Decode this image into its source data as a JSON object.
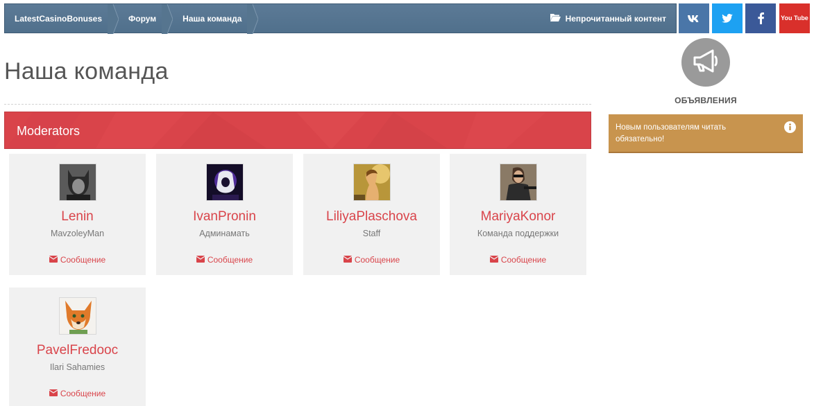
{
  "breadcrumbs": [
    {
      "label": "LatestCasinoBonuses"
    },
    {
      "label": "Форум"
    },
    {
      "label": "Наша команда"
    }
  ],
  "unread": {
    "label": "Непрочитанный контент",
    "icon": "folder-open-icon"
  },
  "social": [
    {
      "name": "vk",
      "icon": "vk-icon",
      "color": "#4a76a8"
    },
    {
      "name": "twitter",
      "icon": "twitter-icon",
      "color": "#1da1f2"
    },
    {
      "name": "facebook",
      "icon": "facebook-icon",
      "color": "#3b5998"
    },
    {
      "name": "youtube",
      "icon": "youtube-icon",
      "color": "#d9302b",
      "text": "You Tube"
    }
  ],
  "page": {
    "title": "Наша команда"
  },
  "group": {
    "title": "Moderators",
    "color": "#d9444a"
  },
  "members": [
    {
      "name": "Lenin",
      "title": "MavzoleyMan",
      "message_label": "Сообщение"
    },
    {
      "name": "IvanPronin",
      "title": "Админамать",
      "message_label": "Сообщение"
    },
    {
      "name": "LiliyaPlaschova",
      "title": "Staff",
      "message_label": "Сообщение"
    },
    {
      "name": "MariyaKonor",
      "title": "Команда поддержки",
      "message_label": "Сообщение"
    },
    {
      "name": "PavelFredooc",
      "title": "Ilari Sahamies",
      "message_label": "Сообщение"
    }
  ],
  "sidebar": {
    "announcements_label": "ОБЪЯВЛЕНИЯ",
    "notice_text": "Новым пользователям читать обязательно!",
    "notice_color": "#c8944e"
  }
}
